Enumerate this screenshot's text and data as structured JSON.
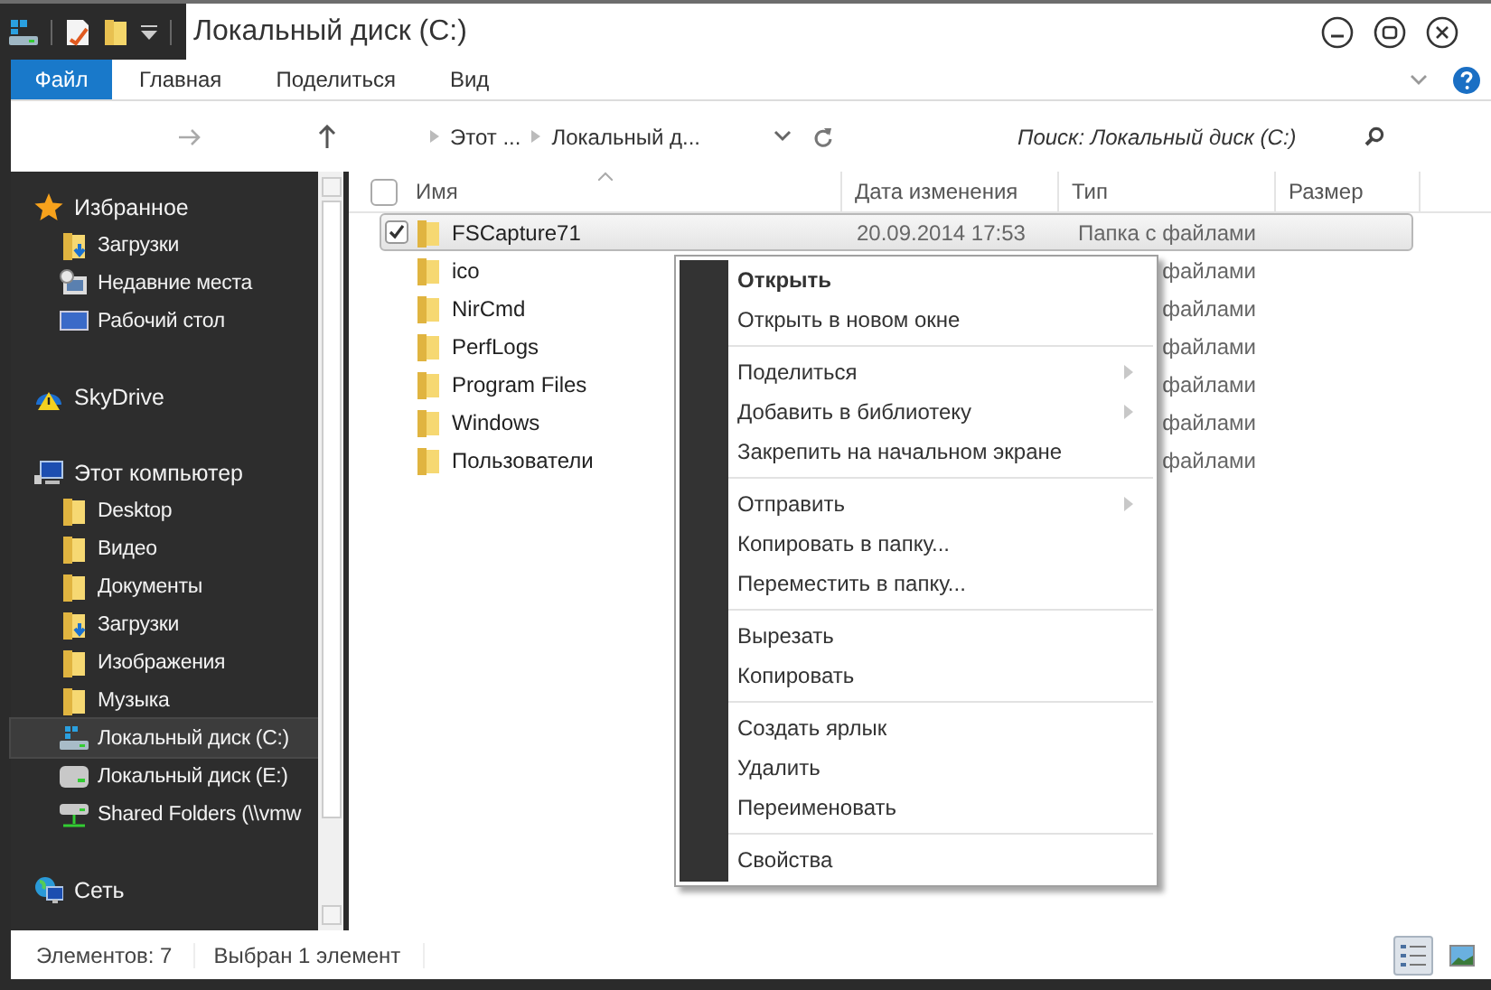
{
  "window": {
    "title": "Локальный диск (C:)"
  },
  "ribbon_tabs": [
    {
      "label": "Файл",
      "selected": true
    },
    {
      "label": "Главная",
      "selected": false
    },
    {
      "label": "Поделиться",
      "selected": false
    },
    {
      "label": "Вид",
      "selected": false
    }
  ],
  "address_bar": {
    "breadcrumbs": [
      "Этот ...",
      "Локальный д..."
    ]
  },
  "search": {
    "placeholder": "Поиск: Локальный диск (C:)"
  },
  "sidebar": {
    "groups": [
      {
        "label": "Избранное",
        "kind": "favorites",
        "selected": false,
        "children": [
          {
            "label": "Загрузки",
            "kind": "downloads",
            "selected": false
          },
          {
            "label": "Недавние места",
            "kind": "recent",
            "selected": false
          },
          {
            "label": "Рабочий стол",
            "kind": "desktop",
            "selected": false
          }
        ]
      },
      {
        "label": "SkyDrive",
        "kind": "cloud",
        "selected": false
      },
      {
        "label": "Этот компьютер",
        "kind": "computer",
        "selected": false,
        "children": [
          {
            "label": "Desktop",
            "kind": "folder",
            "selected": false
          },
          {
            "label": "Видео",
            "kind": "folder",
            "selected": false
          },
          {
            "label": "Документы",
            "kind": "folder",
            "selected": false
          },
          {
            "label": "Загрузки",
            "kind": "downloads",
            "selected": false
          },
          {
            "label": "Изображения",
            "kind": "folder",
            "selected": false
          },
          {
            "label": "Музыка",
            "kind": "folder",
            "selected": false
          },
          {
            "label": "Локальный диск (C:)",
            "kind": "system-drive",
            "selected": true
          },
          {
            "label": "Локальный диск (E:)",
            "kind": "drive",
            "selected": false
          },
          {
            "label": "Shared Folders (\\\\vmw",
            "kind": "network-drive",
            "selected": false
          }
        ]
      },
      {
        "label": "Сеть",
        "kind": "network",
        "selected": false
      }
    ]
  },
  "table": {
    "select_all": {
      "checked": false
    },
    "columns": [
      "Имя",
      "Дата изменения",
      "Тип",
      "Размер"
    ],
    "rows": [
      {
        "name": "FSCapture71",
        "date": "20.09.2014 17:53",
        "type": "Папка с файлами",
        "selected": true
      },
      {
        "name": "ico",
        "type": "файлами",
        "selected": false
      },
      {
        "name": "NirCmd",
        "type": "файлами",
        "selected": false
      },
      {
        "name": "PerfLogs",
        "type": "файлами",
        "selected": false
      },
      {
        "name": "Program Files",
        "type": "файлами",
        "selected": false
      },
      {
        "name": "Windows",
        "type": "файлами",
        "selected": false
      },
      {
        "name": "Пользователи",
        "type": "файлами",
        "selected": false
      }
    ]
  },
  "context_menu": {
    "groups": [
      [
        {
          "label": "Открыть",
          "default": true,
          "submenu": false
        },
        {
          "label": "Открыть в новом окне",
          "default": false,
          "submenu": false
        }
      ],
      [
        {
          "label": "Поделиться",
          "default": false,
          "submenu": true
        },
        {
          "label": "Добавить в библиотеку",
          "default": false,
          "submenu": true
        },
        {
          "label": "Закрепить на начальном экране",
          "default": false,
          "submenu": false
        }
      ],
      [
        {
          "label": "Отправить",
          "default": false,
          "submenu": true
        },
        {
          "label": "Копировать в папку...",
          "default": false,
          "submenu": false
        },
        {
          "label": "Переместить в папку...",
          "default": false,
          "submenu": false
        }
      ],
      [
        {
          "label": "Вырезать",
          "default": false,
          "submenu": false
        },
        {
          "label": "Копировать",
          "default": false,
          "submenu": false
        }
      ],
      [
        {
          "label": "Создать ярлык",
          "default": false,
          "submenu": false
        },
        {
          "label": "Удалить",
          "default": false,
          "submenu": false
        },
        {
          "label": "Переименовать",
          "default": false,
          "submenu": false
        }
      ],
      [
        {
          "label": "Свойства",
          "default": false,
          "submenu": false
        }
      ]
    ]
  },
  "status_bar": {
    "items": [
      "Элементов: 7",
      "Выбран 1 элемент"
    ],
    "views": [
      {
        "kind": "details",
        "selected": true
      },
      {
        "kind": "thumbnails",
        "selected": false
      }
    ]
  }
}
